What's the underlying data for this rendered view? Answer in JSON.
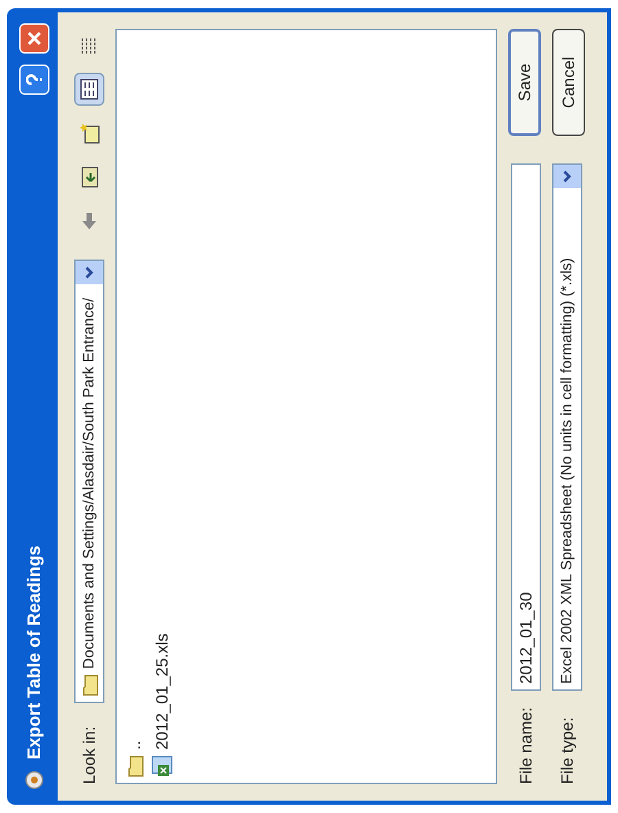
{
  "window": {
    "title": "Export Table of Readings"
  },
  "look_in": {
    "label": "Look in:",
    "value": "Documents and Settings/Alasdair/South Park Entrance/"
  },
  "toolbar": [
    {
      "kind": "back",
      "selected": false
    },
    {
      "kind": "up",
      "selected": false
    },
    {
      "kind": "new-folder",
      "selected": false
    },
    {
      "kind": "list-view",
      "selected": true
    },
    {
      "kind": "details-view",
      "selected": false
    }
  ],
  "files": [
    {
      "kind": "folder",
      "name": ".."
    },
    {
      "kind": "spreadsheet",
      "name": "2012_01_25.xls"
    }
  ],
  "file_name": {
    "label": "File name:",
    "value": "2012_01_30"
  },
  "file_type": {
    "label": "File type:",
    "value": "Excel 2002 XML Spreadsheet (No units in cell formatting) (*.xls)"
  },
  "buttons": [
    "Save",
    "Cancel"
  ]
}
